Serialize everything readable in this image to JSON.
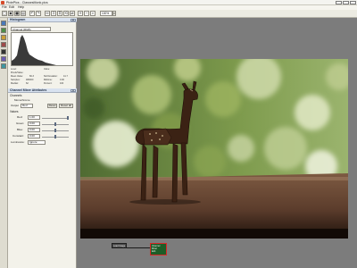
{
  "window": {
    "title": "PixiePics - ClassesMonk.pics",
    "controls": [
      "minimize",
      "maximize",
      "close"
    ]
  },
  "menu": [
    "File",
    "Edit",
    "Help"
  ],
  "toolbar": {
    "zoom": "100%"
  },
  "histogram_panel": {
    "title": "Histogram",
    "channel": "Channel (RGB)",
    "stats": [
      {
        "label": "Level:",
        "value": ""
      },
      {
        "label": "Value:",
        "value": ""
      },
      {
        "label": "Pixels/Value:",
        "value": ""
      },
      {
        "label": "Mean Value:",
        "value": "66.3"
      },
      {
        "label": "Std Deviation:",
        "value": "41.7"
      },
      {
        "label": "Samples:",
        "value": "480000"
      },
      {
        "label": "Midtone:",
        "value": "0.00"
      },
      {
        "label": "Median:",
        "value": "62"
      },
      {
        "label": "Percent:",
        "value": "100"
      }
    ]
  },
  "channel_panel": {
    "title": "Channel Mixer Attributes",
    "section_channels": "Channels",
    "monochrome_label": "Monochrome",
    "output_label": "Output",
    "output_value": "Red",
    "reset_label": "Reset",
    "reset_all_label": "Reset all",
    "section_values": "Values",
    "fields": [
      {
        "label": "Red:",
        "value": "1.00"
      },
      {
        "label": "Green:",
        "value": "0.00"
      },
      {
        "label": "Blue:",
        "value": "0.00"
      },
      {
        "label": "Constant:",
        "value": "0.00"
      }
    ],
    "luminance_label": "Luminance:",
    "luminance_value": "Ignore"
  },
  "nodes": [
    {
      "label": "Load Image"
    },
    {
      "label": "Channel",
      "sub": "Mixer",
      "sub2": "Edit"
    }
  ]
}
